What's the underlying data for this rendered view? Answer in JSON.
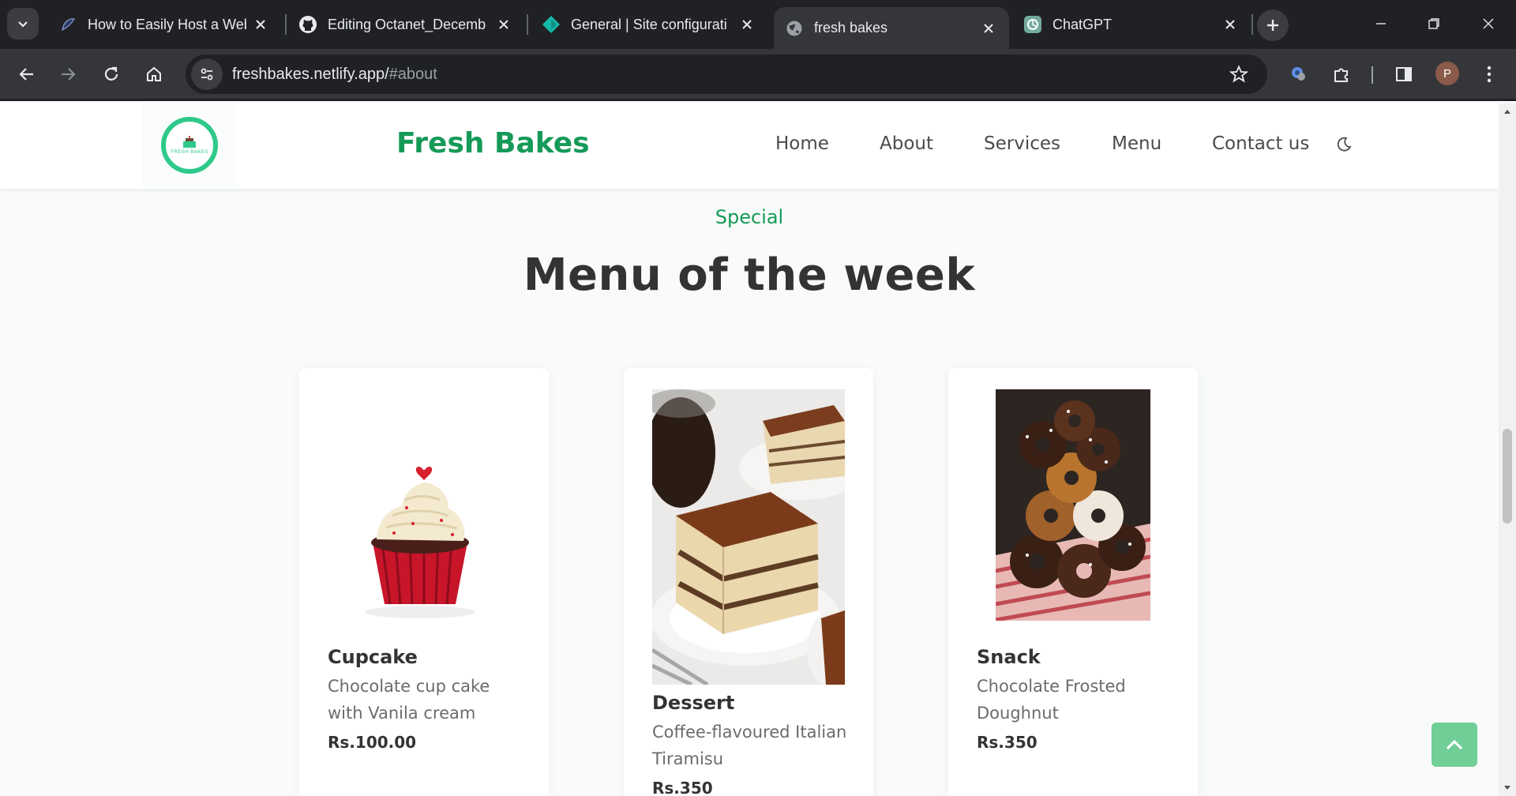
{
  "browser": {
    "tabs": [
      {
        "title": "How to Easily Host a Web",
        "icon": "blog-icon"
      },
      {
        "title": "Editing Octanet_Decemb",
        "icon": "github-icon"
      },
      {
        "title": "General | Site configurati",
        "icon": "netlify-icon"
      },
      {
        "title": "fresh bakes",
        "icon": "globe-icon",
        "active": true
      },
      {
        "title": "ChatGPT",
        "icon": "chatgpt-icon"
      }
    ],
    "url_host": "freshbakes.netlify.app/",
    "url_path": "#about",
    "profile_initial": "P"
  },
  "site": {
    "brand": "Fresh Bakes",
    "logo_text": "FRESH BAKES",
    "nav": [
      "Home",
      "About",
      "Services",
      "Menu",
      "Contact us"
    ],
    "colors": {
      "brand": "#159a58",
      "accent": "#6fcf97"
    }
  },
  "section": {
    "kicker": "Special",
    "title": "Menu of the week"
  },
  "cards": [
    {
      "name": "Cupcake",
      "desc": "Chocolate cup cake with Vanila cream",
      "price": "Rs.100.00",
      "image": "cupcake-image"
    },
    {
      "name": "Dessert",
      "desc": "Coffee-flavoured Italian Tiramisu",
      "price": "Rs.350",
      "image": "tiramisu-image"
    },
    {
      "name": "Snack",
      "desc": "Chocolate Frosted Doughnut",
      "price": "Rs.350",
      "image": "doughnuts-image"
    }
  ]
}
